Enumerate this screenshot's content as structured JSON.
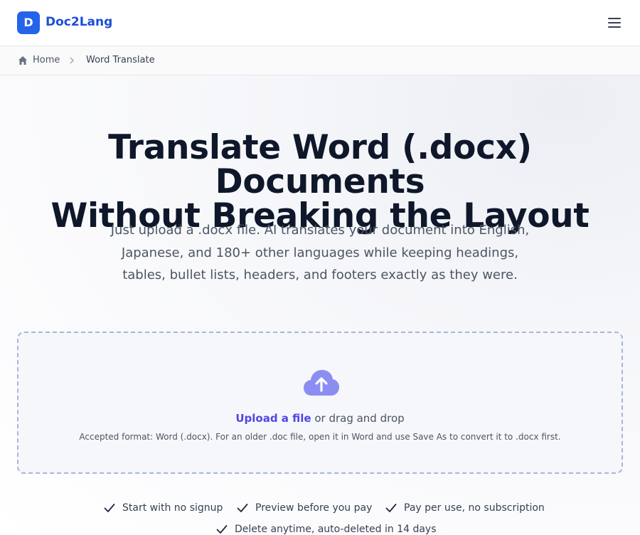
{
  "header": {
    "logo_letter": "D",
    "brand": "Doc2Lang",
    "menu_icon": "hamburger-menu-icon"
  },
  "breadcrumb": {
    "home_icon": "home-icon",
    "home": "Home",
    "separator_icon": "chevron-right-icon",
    "current": "Word Translate"
  },
  "hero": {
    "title_line1": "Translate Word (.docx) Documents",
    "title_line2": "Without Breaking the Layout",
    "subtitle_line1": "Just upload a .docx file. AI translates your document into English,",
    "subtitle_line2": "Japanese, and 180+ other languages while keeping headings,",
    "subtitle_line3": "tables, bullet lists, headers, and footers exactly as they were."
  },
  "upload": {
    "icon": "cloud-upload-icon",
    "link_text": "Upload a file",
    "rest_text": " or drag and drop",
    "accepted_text": "Accepted format: Word (.docx). For an older .doc file, open it in Word and use Save As to convert it to .docx first."
  },
  "features": [
    {
      "label": "Start with no signup",
      "icon": "check-icon"
    },
    {
      "label": "Preview before you pay",
      "icon": "check-icon"
    },
    {
      "label": "Pay per use, no subscription",
      "icon": "check-icon"
    },
    {
      "label": "Delete anytime, auto-deleted in 14 days",
      "icon": "check-icon"
    }
  ],
  "colors": {
    "brand": "#2563eb",
    "link": "#4f46e5",
    "upload_icon": "#8b8ef0",
    "dropzone_border": "#a8b5da"
  }
}
